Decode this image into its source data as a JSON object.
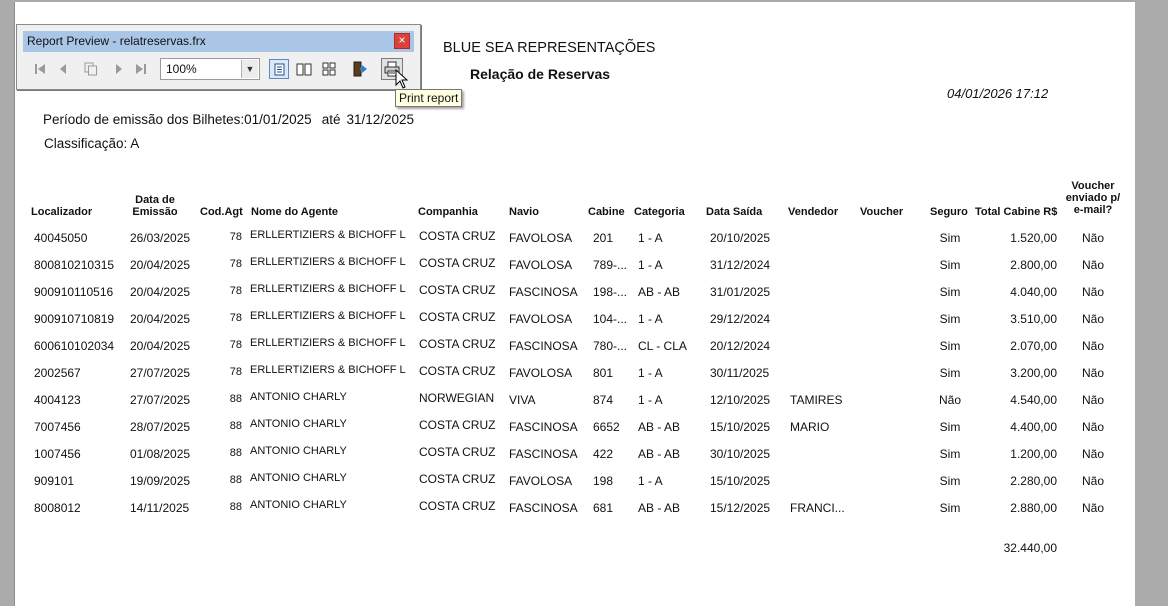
{
  "report": {
    "company": "BLUE SEA REPRESENTAÇÕES",
    "title": "Relação de Reservas",
    "datetime": "04/01/2026 17:12",
    "period_label": "Período de emissão dos Bilhetes:01/01/2025",
    "period_until": "até",
    "period_end": "31/12/2025",
    "classification": "Classificação: A",
    "total": "32.440,00"
  },
  "columns": {
    "localizador": "Localizador",
    "data_emissao": "Data de Emissão",
    "cod_agt": "Cod.Agt",
    "nome_agente": "Nome do Agente",
    "companhia": "Companhia",
    "navio": "Navio",
    "cabine": "Cabine",
    "categoria": "Categoria",
    "data_saida": "Data Saída",
    "vendedor": "Vendedor",
    "voucher": "Voucher",
    "seguro": "Seguro",
    "total_cabine": "Total Cabine R$",
    "voucher_enviado": "Voucher enviado p/ e-mail?"
  },
  "rows": [
    {
      "localizador": "40045050",
      "data": "26/03/2025",
      "cod": "78",
      "agente": "ERLLERTIZIERS & BICHOFF L",
      "companhia": "COSTA CRUZ",
      "navio": "FAVOLOSA",
      "cabine": "201",
      "categoria": "1  - A",
      "saida": "20/10/2025",
      "vendedor": "",
      "voucher": "",
      "seguro": "Sim",
      "total": "1.520,00",
      "enviado": "Não"
    },
    {
      "localizador": "800810210315",
      "data": "20/04/2025",
      "cod": "78",
      "agente": "ERLLERTIZIERS & BICHOFF L",
      "companhia": "COSTA CRUZ",
      "navio": "FAVOLOSA",
      "cabine": "789-...",
      "categoria": "1  - A",
      "saida": "31/12/2024",
      "vendedor": "",
      "voucher": "",
      "seguro": "Sim",
      "total": "2.800,00",
      "enviado": "Não"
    },
    {
      "localizador": "900910110516",
      "data": "20/04/2025",
      "cod": "78",
      "agente": "ERLLERTIZIERS & BICHOFF L",
      "companhia": "COSTA CRUZ",
      "navio": "FASCINOSA",
      "cabine": "198-...",
      "categoria": "AB  - AB",
      "saida": "31/01/2025",
      "vendedor": "",
      "voucher": "",
      "seguro": "Sim",
      "total": "4.040,00",
      "enviado": "Não"
    },
    {
      "localizador": "900910710819",
      "data": "20/04/2025",
      "cod": "78",
      "agente": "ERLLERTIZIERS & BICHOFF L",
      "companhia": "COSTA CRUZ",
      "navio": "FAVOLOSA",
      "cabine": "104-...",
      "categoria": "1  - A",
      "saida": "29/12/2024",
      "vendedor": "",
      "voucher": "",
      "seguro": "Sim",
      "total": "3.510,00",
      "enviado": "Não"
    },
    {
      "localizador": "600610102034",
      "data": "20/04/2025",
      "cod": "78",
      "agente": "ERLLERTIZIERS & BICHOFF L",
      "companhia": "COSTA CRUZ",
      "navio": "FASCINOSA",
      "cabine": "780-...",
      "categoria": "CL  - CLA",
      "saida": "20/12/2024",
      "vendedor": "",
      "voucher": "",
      "seguro": "Sim",
      "total": "2.070,00",
      "enviado": "Não"
    },
    {
      "localizador": "2002567",
      "data": "27/07/2025",
      "cod": "78",
      "agente": "ERLLERTIZIERS & BICHOFF L",
      "companhia": "COSTA CRUZ",
      "navio": "FAVOLOSA",
      "cabine": "801",
      "categoria": "1  - A",
      "saida": "30/11/2025",
      "vendedor": "",
      "voucher": "",
      "seguro": "Sim",
      "total": "3.200,00",
      "enviado": "Não"
    },
    {
      "localizador": "4004123",
      "data": "27/07/2025",
      "cod": "88",
      "agente": "ANTONIO CHARLY",
      "companhia": "NORWEGIAN",
      "navio": "VIVA",
      "cabine": "874",
      "categoria": "1  - A",
      "saida": "12/10/2025",
      "vendedor": "TAMIRES",
      "voucher": "",
      "seguro": "Não",
      "total": "4.540,00",
      "enviado": "Não"
    },
    {
      "localizador": "7007456",
      "data": "28/07/2025",
      "cod": "88",
      "agente": "ANTONIO CHARLY",
      "companhia": "COSTA CRUZ",
      "navio": "FASCINOSA",
      "cabine": "6652",
      "categoria": "AB  - AB",
      "saida": "15/10/2025",
      "vendedor": "MARIO",
      "voucher": "",
      "seguro": "Sim",
      "total": "4.400,00",
      "enviado": "Não"
    },
    {
      "localizador": "1007456",
      "data": "01/08/2025",
      "cod": "88",
      "agente": "ANTONIO CHARLY",
      "companhia": "COSTA CRUZ",
      "navio": "FASCINOSA",
      "cabine": "422",
      "categoria": "AB  - AB",
      "saida": "30/10/2025",
      "vendedor": "",
      "voucher": "",
      "seguro": "Sim",
      "total": "1.200,00",
      "enviado": "Não"
    },
    {
      "localizador": "909101",
      "data": "19/09/2025",
      "cod": "88",
      "agente": "ANTONIO CHARLY",
      "companhia": "COSTA CRUZ",
      "navio": "FAVOLOSA",
      "cabine": "198",
      "categoria": "1  - A",
      "saida": "15/10/2025",
      "vendedor": "",
      "voucher": "",
      "seguro": "Sim",
      "total": "2.280,00",
      "enviado": "Não"
    },
    {
      "localizador": "8008012",
      "data": "14/11/2025",
      "cod": "88",
      "agente": "ANTONIO CHARLY",
      "companhia": "COSTA CRUZ",
      "navio": "FASCINOSA",
      "cabine": "681",
      "categoria": "AB  - AB",
      "saida": "15/12/2025",
      "vendedor": "FRANCI...",
      "voucher": "",
      "seguro": "Sim",
      "total": "2.880,00",
      "enviado": "Não"
    }
  ],
  "preview_window": {
    "title": "Report Preview - relatreservas.frx",
    "close": "×",
    "zoom_value": "100%",
    "tooltip": "Print report",
    "icons": {
      "first": "first-page-icon",
      "prev": "previous-page-icon",
      "copy": "copy-icon",
      "next": "next-page-icon",
      "last": "last-page-icon",
      "one_page": "one-page-icon",
      "two_pages": "two-pages-icon",
      "four_pages": "four-pages-icon",
      "exit": "exit-icon",
      "print": "printer-icon"
    }
  }
}
